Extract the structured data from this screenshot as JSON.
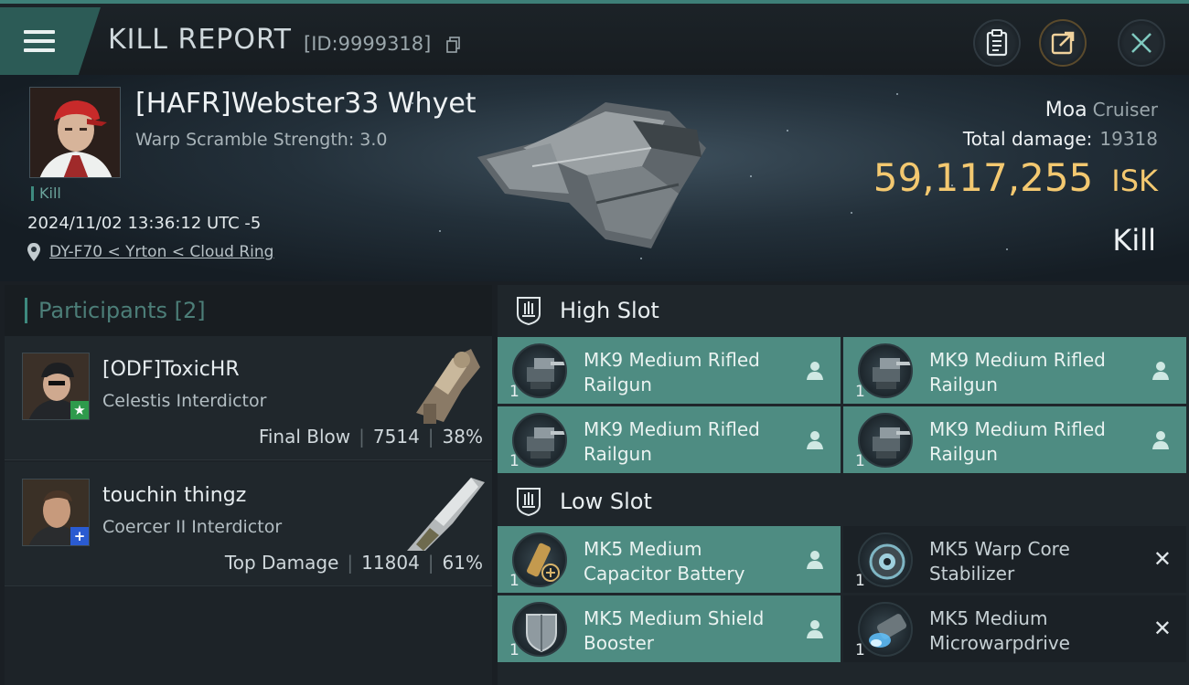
{
  "header": {
    "title": "KILL REPORT",
    "report_id": "[ID:9999318]",
    "victim_name": "[HAFR]Webster33 Whyet",
    "warp_scramble": "Warp Scramble Strength: 3.0",
    "kill_tag": "Kill",
    "timestamp": "2024/11/02 13:36:12 UTC -5",
    "location": "DY-F70 < Yrton < Cloud Ring",
    "ship_name": "Moa",
    "ship_class": "Cruiser",
    "total_damage_label": "Total damage:",
    "total_damage_value": "19318",
    "isk_value": "59,117,255",
    "isk_unit": "ISK",
    "result": "Kill"
  },
  "participants": {
    "title": "Participants [2]",
    "rows": [
      {
        "name": "[ODF]ToxicHR",
        "ship": "Celestis Interdictor",
        "role": "Final Blow",
        "damage": "7514",
        "percent": "38%",
        "badge": "★",
        "badge_color": "#2e9a4c"
      },
      {
        "name": "touchin thingz",
        "ship": "Coercer II Interdictor",
        "role": "Top Damage",
        "damage": "11804",
        "percent": "61%",
        "badge": "+",
        "badge_color": "#2a5bd1"
      }
    ]
  },
  "slots": {
    "high_label": "High Slot",
    "low_label": "Low Slot",
    "high_items": [
      {
        "line1": "MK9 Medium Rifled",
        "line2": "Railgun",
        "qty": "1",
        "state": "fit",
        "icon": "railgun-icon"
      },
      {
        "line1": "MK9 Medium Rifled",
        "line2": "Railgun",
        "qty": "1",
        "state": "fit",
        "icon": "railgun-icon"
      },
      {
        "line1": "MK9 Medium Rifled",
        "line2": "Railgun",
        "qty": "1",
        "state": "fit",
        "icon": "railgun-icon"
      },
      {
        "line1": "MK9 Medium Rifled",
        "line2": "Railgun",
        "qty": "1",
        "state": "fit",
        "icon": "railgun-icon"
      }
    ],
    "low_items": [
      {
        "line1": "MK5 Medium",
        "line2": "Capacitor Battery",
        "qty": "1",
        "state": "fit",
        "icon": "capacitor-battery-icon"
      },
      {
        "line1": "MK5 Warp Core",
        "line2": "Stabilizer",
        "qty": "1",
        "state": "lost",
        "icon": "warp-core-stabilizer-icon"
      },
      {
        "line1": "MK5 Medium Shield",
        "line2": "Booster",
        "qty": "1",
        "state": "fit",
        "icon": "shield-booster-icon"
      },
      {
        "line1": "MK5 Medium",
        "line2": "Microwarpdrive",
        "qty": "1",
        "state": "lost",
        "icon": "microwarpdrive-icon"
      }
    ]
  },
  "colors": {
    "accent": "#4e8c82",
    "isk": "#f3c870",
    "background": "#1a1f24"
  }
}
